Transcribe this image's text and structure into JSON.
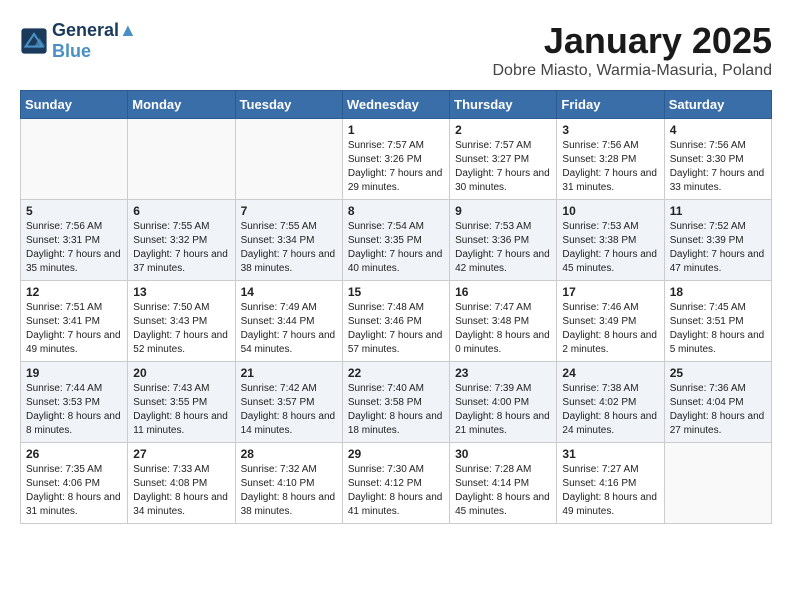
{
  "header": {
    "logo_line1": "General",
    "logo_line2": "Blue",
    "month": "January 2025",
    "location": "Dobre Miasto, Warmia-Masuria, Poland"
  },
  "weekdays": [
    "Sunday",
    "Monday",
    "Tuesday",
    "Wednesday",
    "Thursday",
    "Friday",
    "Saturday"
  ],
  "weeks": [
    [
      {
        "day": "",
        "info": ""
      },
      {
        "day": "",
        "info": ""
      },
      {
        "day": "",
        "info": ""
      },
      {
        "day": "1",
        "info": "Sunrise: 7:57 AM\nSunset: 3:26 PM\nDaylight: 7 hours and 29 minutes."
      },
      {
        "day": "2",
        "info": "Sunrise: 7:57 AM\nSunset: 3:27 PM\nDaylight: 7 hours and 30 minutes."
      },
      {
        "day": "3",
        "info": "Sunrise: 7:56 AM\nSunset: 3:28 PM\nDaylight: 7 hours and 31 minutes."
      },
      {
        "day": "4",
        "info": "Sunrise: 7:56 AM\nSunset: 3:30 PM\nDaylight: 7 hours and 33 minutes."
      }
    ],
    [
      {
        "day": "5",
        "info": "Sunrise: 7:56 AM\nSunset: 3:31 PM\nDaylight: 7 hours and 35 minutes."
      },
      {
        "day": "6",
        "info": "Sunrise: 7:55 AM\nSunset: 3:32 PM\nDaylight: 7 hours and 37 minutes."
      },
      {
        "day": "7",
        "info": "Sunrise: 7:55 AM\nSunset: 3:34 PM\nDaylight: 7 hours and 38 minutes."
      },
      {
        "day": "8",
        "info": "Sunrise: 7:54 AM\nSunset: 3:35 PM\nDaylight: 7 hours and 40 minutes."
      },
      {
        "day": "9",
        "info": "Sunrise: 7:53 AM\nSunset: 3:36 PM\nDaylight: 7 hours and 42 minutes."
      },
      {
        "day": "10",
        "info": "Sunrise: 7:53 AM\nSunset: 3:38 PM\nDaylight: 7 hours and 45 minutes."
      },
      {
        "day": "11",
        "info": "Sunrise: 7:52 AM\nSunset: 3:39 PM\nDaylight: 7 hours and 47 minutes."
      }
    ],
    [
      {
        "day": "12",
        "info": "Sunrise: 7:51 AM\nSunset: 3:41 PM\nDaylight: 7 hours and 49 minutes."
      },
      {
        "day": "13",
        "info": "Sunrise: 7:50 AM\nSunset: 3:43 PM\nDaylight: 7 hours and 52 minutes."
      },
      {
        "day": "14",
        "info": "Sunrise: 7:49 AM\nSunset: 3:44 PM\nDaylight: 7 hours and 54 minutes."
      },
      {
        "day": "15",
        "info": "Sunrise: 7:48 AM\nSunset: 3:46 PM\nDaylight: 7 hours and 57 minutes."
      },
      {
        "day": "16",
        "info": "Sunrise: 7:47 AM\nSunset: 3:48 PM\nDaylight: 8 hours and 0 minutes."
      },
      {
        "day": "17",
        "info": "Sunrise: 7:46 AM\nSunset: 3:49 PM\nDaylight: 8 hours and 2 minutes."
      },
      {
        "day": "18",
        "info": "Sunrise: 7:45 AM\nSunset: 3:51 PM\nDaylight: 8 hours and 5 minutes."
      }
    ],
    [
      {
        "day": "19",
        "info": "Sunrise: 7:44 AM\nSunset: 3:53 PM\nDaylight: 8 hours and 8 minutes."
      },
      {
        "day": "20",
        "info": "Sunrise: 7:43 AM\nSunset: 3:55 PM\nDaylight: 8 hours and 11 minutes."
      },
      {
        "day": "21",
        "info": "Sunrise: 7:42 AM\nSunset: 3:57 PM\nDaylight: 8 hours and 14 minutes."
      },
      {
        "day": "22",
        "info": "Sunrise: 7:40 AM\nSunset: 3:58 PM\nDaylight: 8 hours and 18 minutes."
      },
      {
        "day": "23",
        "info": "Sunrise: 7:39 AM\nSunset: 4:00 PM\nDaylight: 8 hours and 21 minutes."
      },
      {
        "day": "24",
        "info": "Sunrise: 7:38 AM\nSunset: 4:02 PM\nDaylight: 8 hours and 24 minutes."
      },
      {
        "day": "25",
        "info": "Sunrise: 7:36 AM\nSunset: 4:04 PM\nDaylight: 8 hours and 27 minutes."
      }
    ],
    [
      {
        "day": "26",
        "info": "Sunrise: 7:35 AM\nSunset: 4:06 PM\nDaylight: 8 hours and 31 minutes."
      },
      {
        "day": "27",
        "info": "Sunrise: 7:33 AM\nSunset: 4:08 PM\nDaylight: 8 hours and 34 minutes."
      },
      {
        "day": "28",
        "info": "Sunrise: 7:32 AM\nSunset: 4:10 PM\nDaylight: 8 hours and 38 minutes."
      },
      {
        "day": "29",
        "info": "Sunrise: 7:30 AM\nSunset: 4:12 PM\nDaylight: 8 hours and 41 minutes."
      },
      {
        "day": "30",
        "info": "Sunrise: 7:28 AM\nSunset: 4:14 PM\nDaylight: 8 hours and 45 minutes."
      },
      {
        "day": "31",
        "info": "Sunrise: 7:27 AM\nSunset: 4:16 PM\nDaylight: 8 hours and 49 minutes."
      },
      {
        "day": "",
        "info": ""
      }
    ]
  ]
}
